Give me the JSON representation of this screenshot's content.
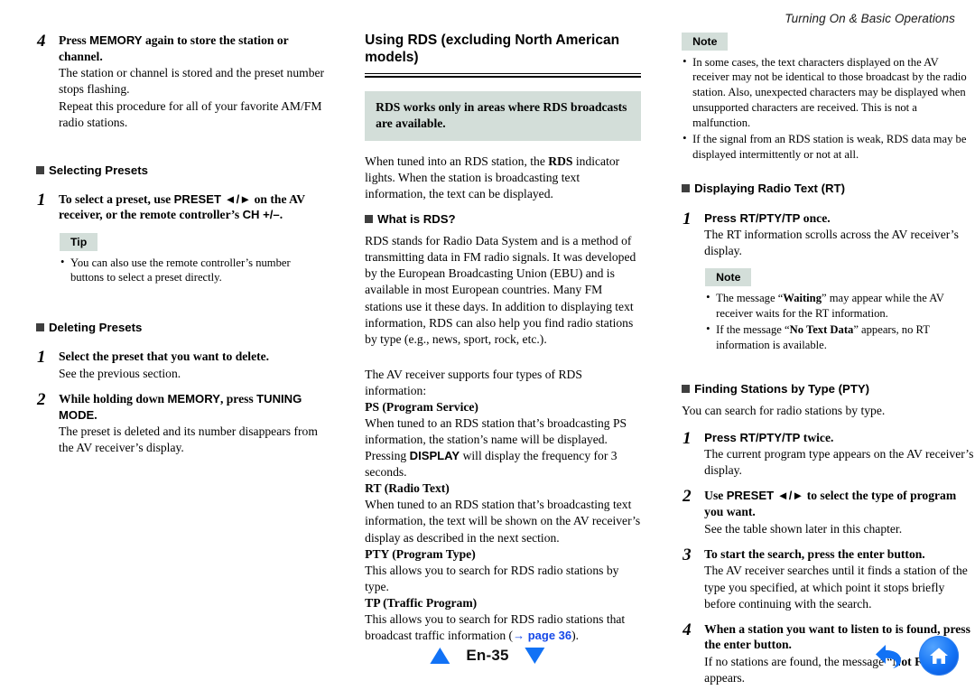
{
  "header": {
    "running_title": "Turning On & Basic Operations"
  },
  "left_column": {
    "step4": {
      "number": "4",
      "title": "Press MEMORY again to store the station or channel.",
      "desc1": "The station or channel is stored and the preset number stops flashing.",
      "desc2": "Repeat this procedure for all of your favorite AM/FM radio stations."
    },
    "selecting_presets": {
      "heading": "Selecting Presets",
      "step1": {
        "number": "1",
        "title": "To select a preset, use PRESET ◄/► on the AV receiver, or the remote controller’s CH +/–."
      },
      "tip_badge": "Tip",
      "tip_items": [
        "You can also use the remote controller’s number buttons to select a preset directly."
      ]
    },
    "deleting_presets": {
      "heading": "Deleting Presets",
      "step1": {
        "number": "1",
        "title": "Select the preset that you want to delete.",
        "desc": "See the previous section."
      },
      "step2": {
        "number": "2",
        "title": "While holding down MEMORY, press TUNING MODE.",
        "desc": "The preset is deleted and its number disappears from the AV receiver’s display."
      }
    }
  },
  "middle_column": {
    "section_title": "Using RDS (excluding North American models)",
    "callout": "RDS works only in areas where RDS broadcasts are available.",
    "intro": "When tuned into an RDS station, the RDS indicator lights. When the station is broadcasting text information, the text can be displayed.",
    "what_is_rds": {
      "heading": "What is RDS?",
      "body": "RDS stands for Radio Data System and is a method of transmitting data in FM radio signals. It was developed by the European Broadcasting Union (EBU) and is available in most European countries. Many FM stations use it these days. In addition to displaying text information, RDS can also help you find radio stations by type (e.g., news, sport, rock, etc.)."
    },
    "types_intro": "The AV receiver supports four types of RDS information:",
    "types": [
      {
        "name": "PS (Program Service)",
        "desc_before": "When tuned to an RDS station that’s broadcasting PS information, the station’s name will be displayed. Pressing ",
        "desc_key": "DISPLAY",
        "desc_after": " will display the frequency for 3 seconds."
      },
      {
        "name": "RT (Radio Text)",
        "desc": "When tuned to an RDS station that’s broadcasting text information, the text will be shown on the AV receiver’s display as described in the next section."
      },
      {
        "name": "PTY (Program Type)",
        "desc": "This allows you to search for RDS radio stations by type."
      },
      {
        "name": "TP (Traffic Program)",
        "desc_before": "This allows you to search for RDS radio stations that broadcast traffic information (",
        "link": "→ page 36",
        "desc_after": ")."
      }
    ]
  },
  "right_column": {
    "note_badge": "Note",
    "notes": [
      "In some cases, the text characters displayed on the AV receiver may not be identical to those broadcast by the radio station. Also, unexpected characters may be displayed when unsupported characters are received. This is not a malfunction.",
      "If the signal from an RDS station is weak, RDS data may be displayed intermittently or not at all."
    ],
    "radio_text": {
      "heading": "Displaying Radio Text (RT)",
      "step1": {
        "number": "1",
        "title": "Press RT/PTY/TP once.",
        "desc": "The RT information scrolls across the AV receiver’s display."
      },
      "note_badge": "Note",
      "notes": [
        {
          "before": "The message “",
          "key": "Waiting",
          "after": "” may appear while the AV receiver waits for the RT information."
        },
        {
          "before": "If the message “",
          "key": "No Text Data",
          "after": "” appears, no RT information is available."
        }
      ]
    },
    "pty": {
      "heading": "Finding Stations by Type (PTY)",
      "intro": "You can search for radio stations by type.",
      "step1": {
        "number": "1",
        "title": "Press RT/PTY/TP twice.",
        "desc": "The current program type appears on the AV receiver’s display."
      },
      "step2": {
        "number": "2",
        "title": "Use PRESET ◄/► to select the type of program you want.",
        "desc": "See the table shown later in this chapter."
      },
      "step3": {
        "number": "3",
        "title": "To start the search, press the enter button.",
        "desc": "The AV receiver searches until it finds a station of the type you specified, at which point it stops briefly before continuing with the search."
      },
      "step4": {
        "number": "4",
        "title": "When a station you want to listen to is found, press the enter button.",
        "desc_before": "If no stations are found, the message “",
        "desc_key": "Not Found",
        "desc_after": "” appears."
      }
    }
  },
  "footer": {
    "page_label": "En-35",
    "prev_icon": "triangle-up-icon",
    "next_icon": "triangle-down-icon",
    "back_icon": "back-arrow-icon",
    "home_icon": "home-icon"
  },
  "colors": {
    "tint": "#d3ded9",
    "link": "#1548e8",
    "nav_blue": "#1272f5",
    "bullet_square": "#3f3f3f"
  }
}
